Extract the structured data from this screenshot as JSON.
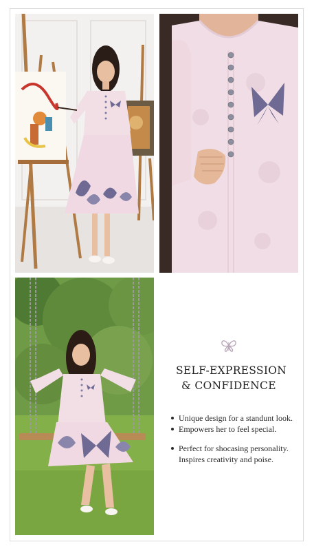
{
  "panel": {
    "heading_line1": "SELF-EXPRESSION",
    "heading_line2": "& CONFIDENCE",
    "bullets": [
      "Unique design for a standunt look.",
      "Empowers her to feel special.",
      "Perfect for shocasing personality.",
      "Inspires creativity and poise."
    ],
    "logo_icon": "butterfly-icon"
  },
  "photos": [
    {
      "name": "girl-painting-at-easel-photo"
    },
    {
      "name": "dress-closeup-photo"
    },
    {
      "name": "girl-on-swing-photo"
    }
  ],
  "colors": {
    "dress_pink": "#f2dfe6",
    "butterfly_purple": "#6e6a94",
    "grass_green": "#7fa64a",
    "foliage_green": "#4f7a33"
  }
}
